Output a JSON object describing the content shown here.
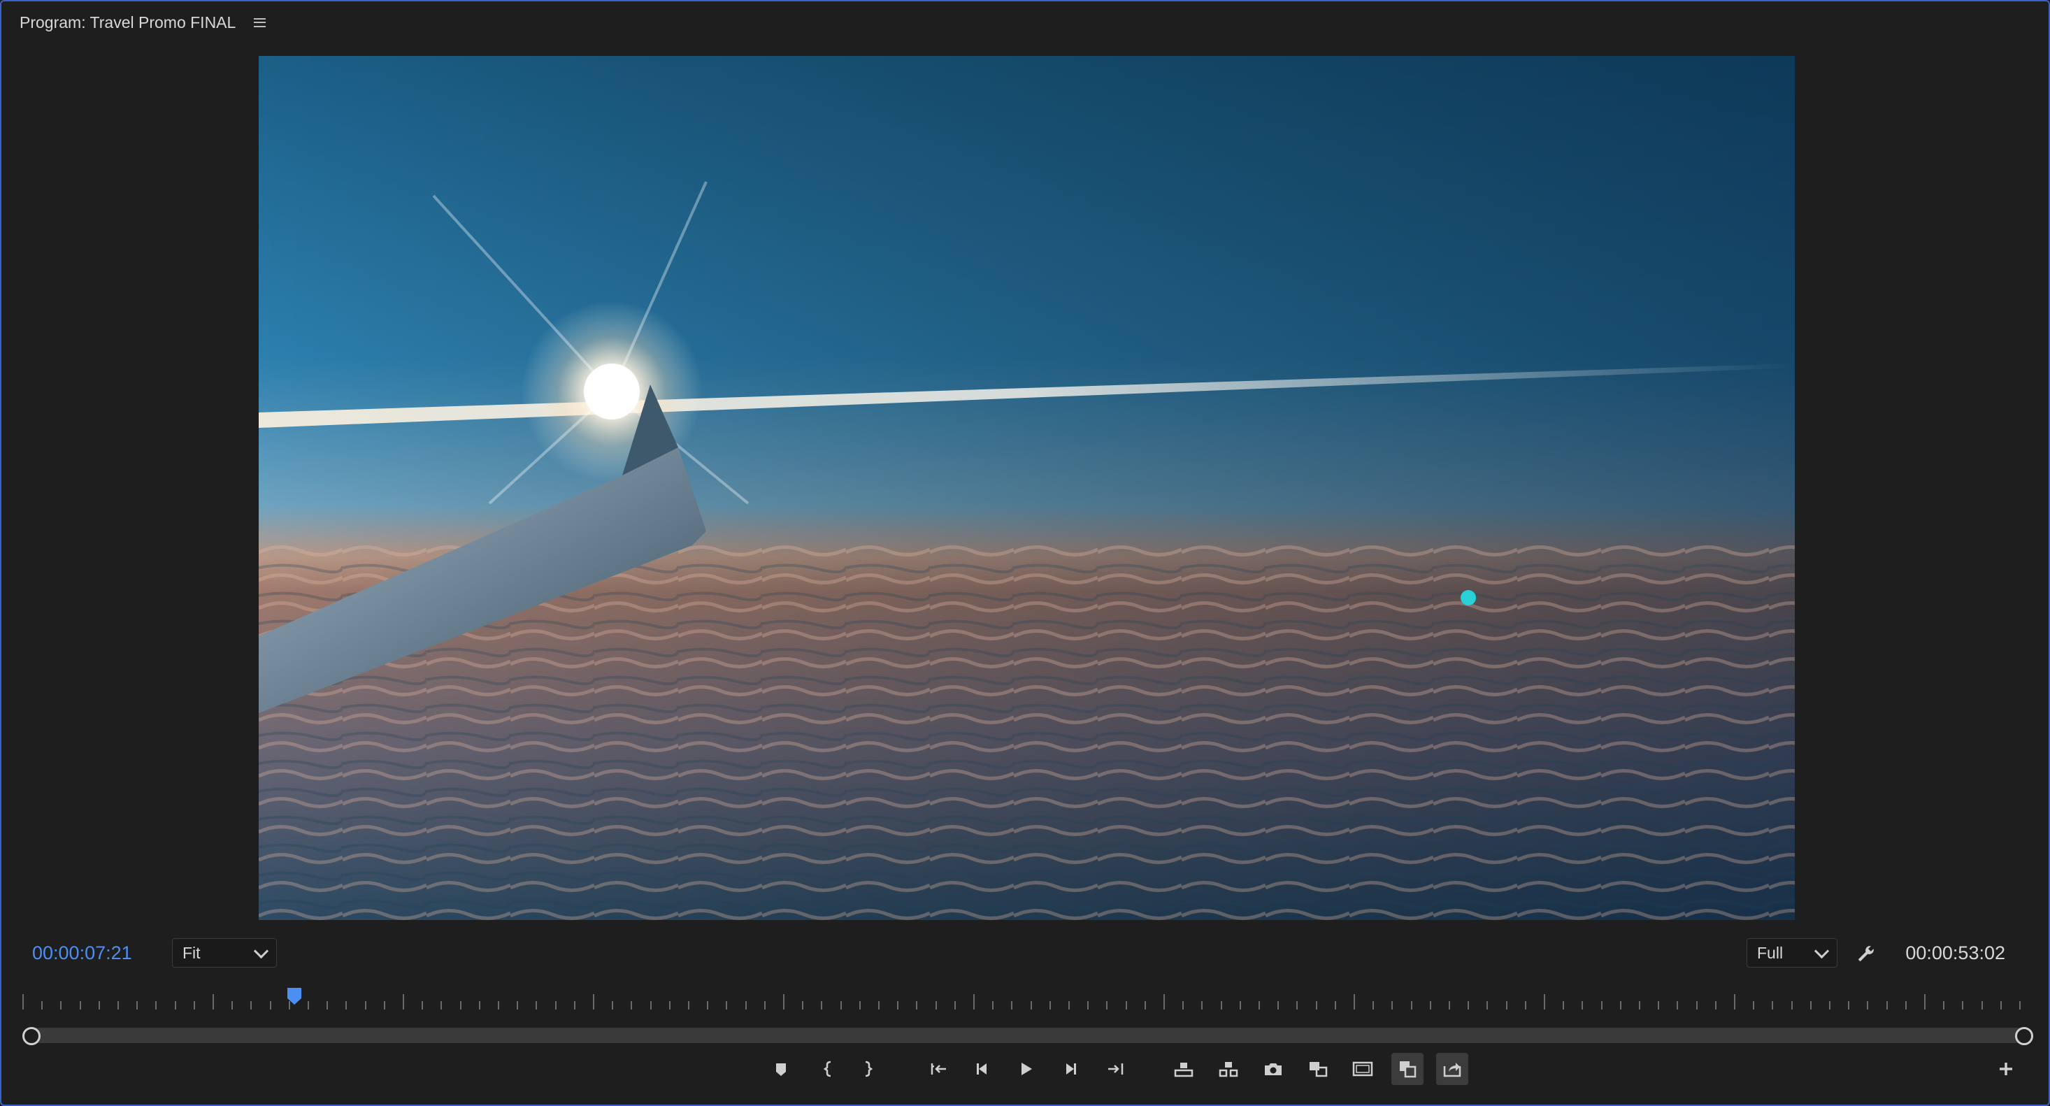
{
  "panel": {
    "title": "Program: Travel Promo FINAL"
  },
  "timecode": {
    "current": "00:00:07:21",
    "duration": "00:00:53:02"
  },
  "zoom": {
    "selected": "Fit"
  },
  "resolution": {
    "selected": "Full"
  },
  "playhead_position_fraction": 0.136,
  "colors": {
    "accent_timecode": "#4d8ff0",
    "panel_border": "#3b63c7",
    "background": "#1e1e1e"
  },
  "controls": {
    "icons": [
      "add-marker-icon",
      "mark-in-icon",
      "mark-out-icon",
      "go-to-in-icon",
      "step-back-icon",
      "play-icon",
      "step-forward-icon",
      "go-to-out-icon",
      "lift-icon",
      "extract-icon",
      "export-frame-icon",
      "comparison-view-icon",
      "safe-margins-icon",
      "toggle-proxies-icon",
      "export-icon",
      "add-button-icon"
    ]
  }
}
